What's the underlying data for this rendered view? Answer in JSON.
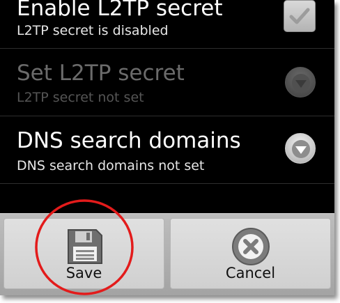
{
  "preferences": [
    {
      "title": "Enable L2TP secret",
      "summary": "L2TP secret is disabled",
      "widget": "checkbox-icon",
      "enabled": true
    },
    {
      "title": "Set L2TP secret",
      "summary": "L2TP secret not set",
      "widget": "chevron-down-icon",
      "enabled": false
    },
    {
      "title": "DNS search domains",
      "summary": "DNS search domains not set",
      "widget": "chevron-down-icon",
      "enabled": true
    }
  ],
  "buttons": {
    "save_label": "Save",
    "save_icon": "floppy-disk-icon",
    "cancel_label": "Cancel",
    "cancel_icon": "cancel-x-icon"
  },
  "colors": {
    "background": "#000000",
    "button_bar": "#b0b0b0",
    "highlight_ring": "#e31b1b"
  }
}
